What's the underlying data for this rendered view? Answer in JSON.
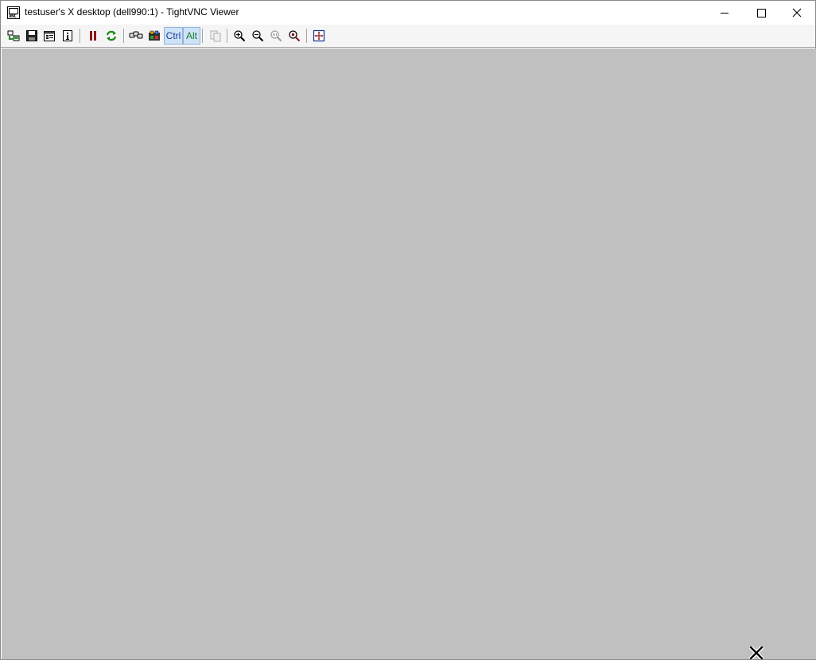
{
  "window": {
    "title": "testuser's X desktop (dell990:1) - TightVNC Viewer",
    "app_icon_text": "VNC",
    "controls": {
      "minimize": "minimize-icon",
      "maximize": "maximize-icon",
      "close": "close-icon"
    }
  },
  "toolbar": {
    "buttons": [
      {
        "name": "new-connection-button",
        "icon": "new-connection-icon"
      },
      {
        "name": "save-session-button",
        "icon": "floppy-disk-icon"
      },
      {
        "name": "options-button",
        "icon": "options-icon"
      },
      {
        "name": "connection-info-button",
        "icon": "info-icon"
      },
      {
        "name": "pause-button",
        "icon": "pause-icon"
      },
      {
        "name": "refresh-button",
        "icon": "refresh-icon"
      },
      {
        "name": "ctrl-alt-del-button",
        "icon": "ctrl-alt-del-icon"
      },
      {
        "name": "ctrl-esc-button",
        "icon": "ctrl-esc-icon"
      },
      {
        "name": "transfer-files-button",
        "icon": "transfer-files-icon"
      },
      {
        "name": "zoom-in-button",
        "icon": "zoom-in-icon"
      },
      {
        "name": "zoom-out-button",
        "icon": "zoom-out-icon"
      },
      {
        "name": "zoom-100-button",
        "icon": "zoom-100-icon"
      },
      {
        "name": "zoom-auto-button",
        "icon": "zoom-auto-icon"
      },
      {
        "name": "fullscreen-button",
        "icon": "fullscreen-icon"
      }
    ],
    "ctrl_label": "Ctrl",
    "alt_label": "Alt"
  },
  "remote_desktop": {
    "background_color": "#c0c0c0",
    "cursor": "x-cursor-icon"
  },
  "colors": {
    "remote_background": "#c0c0c0",
    "key_toggle_background": "#cfe3f7",
    "pause_red": "#8b1a1a",
    "refresh_green": "#1a8a1a"
  }
}
